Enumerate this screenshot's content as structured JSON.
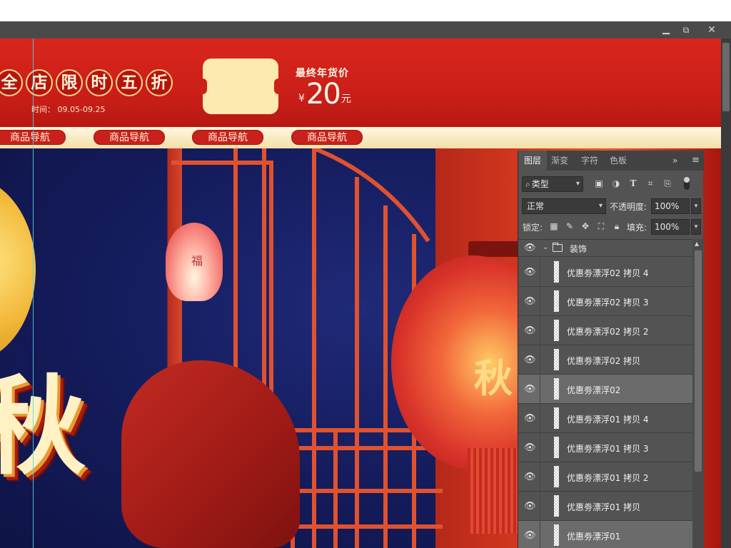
{
  "window": {
    "minimize_glyph": "▁",
    "restore_glyph": "⧉",
    "close_glyph": "✕"
  },
  "banner": {
    "promo_chars": [
      "全",
      "店",
      "限",
      "时",
      "五",
      "折"
    ],
    "time_text": "时间：  09.05-09.25",
    "final_label": "最终年货价",
    "price_currency": "¥",
    "price_value": "20",
    "price_unit": "元"
  },
  "nav": {
    "items": [
      "商品导航",
      "商品导航",
      "商品导航",
      "商品导航"
    ]
  },
  "scene": {
    "sky_lantern_char": "福",
    "lantern_char": "秋",
    "big_title": "秋"
  },
  "layers_panel": {
    "tabs": [
      "图层",
      "渐变",
      "字符",
      "色板"
    ],
    "active_tab": "图层",
    "more_glyph": "»",
    "menu_glyph": "≡",
    "filter_label": "类型",
    "filter_icons": [
      "image-filter-icon",
      "adjustment-filter-icon",
      "text-filter-icon",
      "shape-filter-icon",
      "smart-object-filter-icon"
    ],
    "blend_mode": "正常",
    "opacity_label": "不透明度:",
    "opacity_value": "100%",
    "lock_label": "锁定:",
    "fill_label": "填充:",
    "fill_value": "100%",
    "group_name": "装饰",
    "layers": [
      {
        "name": "优惠劵漂浮02 拷贝 4",
        "selected": false
      },
      {
        "name": "优惠劵漂浮02 拷贝 3",
        "selected": false
      },
      {
        "name": "优惠劵漂浮02 拷贝 2",
        "selected": false
      },
      {
        "name": "优惠劵漂浮02 拷贝",
        "selected": false
      },
      {
        "name": "优惠劵漂浮02",
        "selected": true
      },
      {
        "name": "优惠劵漂浮01 拷贝 4",
        "selected": false
      },
      {
        "name": "优惠劵漂浮01 拷贝 3",
        "selected": false
      },
      {
        "name": "优惠劵漂浮01 拷贝 2",
        "selected": false
      },
      {
        "name": "优惠劵漂浮01 拷贝",
        "selected": false
      },
      {
        "name": "优惠劵漂浮01",
        "selected": true
      }
    ]
  },
  "colors": {
    "banner_red": "#d9261c",
    "panel_bg": "#535353",
    "selected_row": "#6b6b6b",
    "guide_cyan": "#59d6e3"
  }
}
